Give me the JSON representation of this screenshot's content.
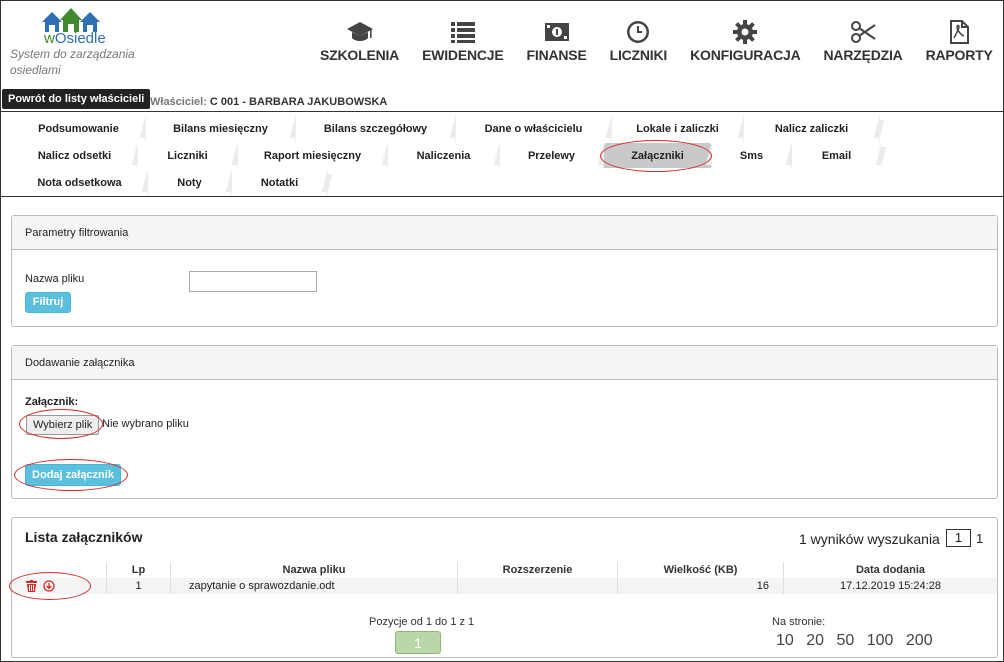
{
  "app": {
    "brand_prefix": "w",
    "brand_name": "Osiedle",
    "tagline": "System do zarządzania osiedlami"
  },
  "topnav": [
    {
      "label": "SZKOLENIA",
      "icon": "graduation-cap-icon"
    },
    {
      "label": "EWIDENCJE",
      "icon": "list-icon"
    },
    {
      "label": "FINANSE",
      "icon": "money-icon"
    },
    {
      "label": "LICZNIKI",
      "icon": "clock-icon"
    },
    {
      "label": "KONFIGURACJA",
      "icon": "gear-icon"
    },
    {
      "label": "NARZĘDZIA",
      "icon": "scissors-icon"
    },
    {
      "label": "RAPORTY",
      "icon": "pdf-file-icon"
    }
  ],
  "header": {
    "back_label": "Powrót do listy właścicieli",
    "owner_label": "Właściciel:",
    "owner_value": "C 001 - BARBARA JAKUBOWSKA"
  },
  "tabs": [
    {
      "label": "Podsumowanie"
    },
    {
      "label": "Bilans miesięczny"
    },
    {
      "label": "Bilans szczegółowy"
    },
    {
      "label": "Dane o właścicielu"
    },
    {
      "label": "Lokale i zaliczki"
    },
    {
      "label": "Nalicz zaliczki"
    },
    {
      "label": "Nalicz odsetki"
    },
    {
      "label": "Liczniki"
    },
    {
      "label": "Raport miesięczny"
    },
    {
      "label": "Naliczenia"
    },
    {
      "label": "Przelewy"
    },
    {
      "label": "Załączniki",
      "active": true
    },
    {
      "label": "Sms"
    },
    {
      "label": "Email"
    },
    {
      "label": "Nota odsetkowa"
    },
    {
      "label": "Noty"
    },
    {
      "label": "Notatki"
    }
  ],
  "filter": {
    "title": "Parametry filtrowania",
    "name_label": "Nazwa pliku",
    "name_value": "",
    "button": "Filtruj"
  },
  "upload": {
    "title": "Dodawanie załącznika",
    "field_label": "Załącznik:",
    "choose_button": "Wybierz plik",
    "no_file": "Nie wybrano pliku",
    "add_button": "Dodaj załącznik"
  },
  "list": {
    "title": "Lista załączników",
    "results_text": "1 wyników wyszukania",
    "current_page": "1",
    "total_pages": "1",
    "columns": [
      "",
      "Lp",
      "Nazwa pliku",
      "Rozszerzenie",
      "Wielkość (KB)",
      "Data dodania"
    ],
    "rows": [
      {
        "lp": "1",
        "name": "zapytanie o sprawozdanie.odt",
        "ext": "",
        "size": "16",
        "date": "17.12.2019 15:24:28"
      }
    ],
    "position_text": "Pozycje od 1 do 1 z 1",
    "page_button": "1",
    "per_page_label": "Na stronie:",
    "per_page_options": [
      "10",
      "20",
      "50",
      "100",
      "200"
    ]
  },
  "colors": {
    "accent": "#5bc0de",
    "danger": "#d62a2a",
    "page_active": "#b8d8a8"
  }
}
